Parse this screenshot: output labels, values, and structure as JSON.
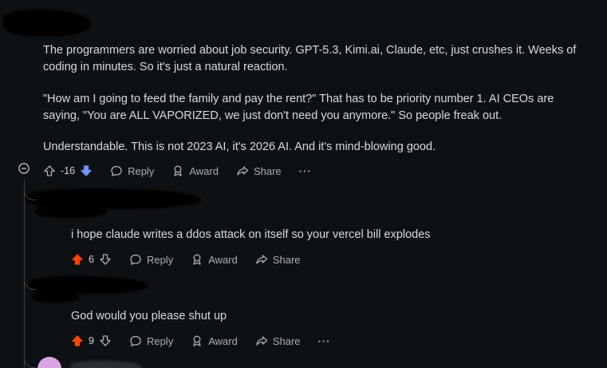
{
  "parent_comment": {
    "paragraphs": [
      "The programmers are worried about job security. GPT-5.3, Kimi.ai, Claude, etc, just crushes it. Weeks of coding in minutes. So it's just a natural reaction.",
      "\"How am I going to feed the family and pay the rent?\" That has to be priority number 1. AI CEOs are saying, \"You are ALL VAPORIZED, we just don't need you anymore.\" So people freak out.",
      "Understandable. This is not 2023 AI, it's 2026 AI. And it's mind-blowing good."
    ],
    "score": "-16",
    "vote_state": "downvoted",
    "actions": {
      "reply": "Reply",
      "award": "Award",
      "share": "Share",
      "more": "···"
    }
  },
  "replies": [
    {
      "text": "i hope claude writes a ddos attack on itself so your vercel bill explodes",
      "score": "6",
      "vote_state": "upvoted",
      "actions": {
        "reply": "Reply",
        "award": "Award",
        "share": "Share"
      }
    },
    {
      "text": "God would you please shut up",
      "score": "9",
      "vote_state": "upvoted",
      "actions": {
        "reply": "Reply",
        "award": "Award",
        "share": "Share",
        "more": "···"
      }
    }
  ],
  "colors": {
    "background": "#0e1113",
    "upvote": "#ff4500",
    "downvote": "#7193ff",
    "text": "#d7dadc",
    "muted": "#a7b0b5",
    "avatar": "#d9a4e3"
  },
  "icons": {
    "collapse": "minus-circle-icon",
    "upvote": "arrow-up-icon",
    "downvote": "arrow-down-icon",
    "reply": "speech-bubble-icon",
    "award": "award-icon",
    "share": "share-icon"
  }
}
